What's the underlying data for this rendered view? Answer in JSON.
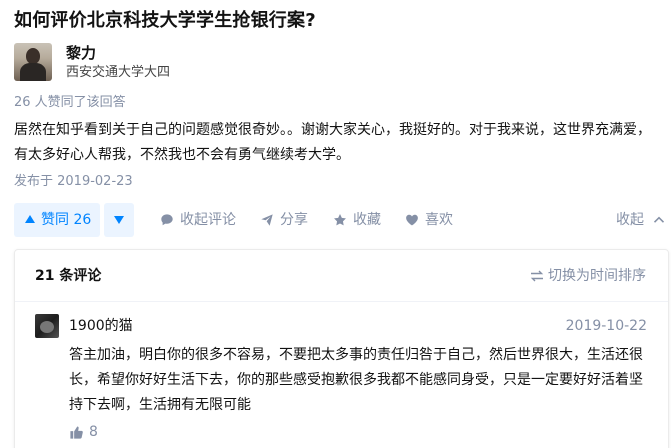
{
  "question": {
    "title": "如何评价北京科技大学学生抢银行案?"
  },
  "author": {
    "name": "黎力",
    "bio": "西安交通大学大四"
  },
  "answer": {
    "vote_summary": "26 人赞同了该回答",
    "content": "居然在知乎看到关于自己的问题感觉很奇妙。。谢谢大家关心，我挺好的。对于我来说，这世界充满爱，有太多好心人帮我，不然我也不会有勇气继续考大学。",
    "published": "发布于 2019-02-23"
  },
  "actions": {
    "upvote_label": "赞同 26",
    "comment_label": "收起评论",
    "share_label": "分享",
    "collect_label": "收藏",
    "like_label": "喜欢",
    "collapse_label": "收起"
  },
  "comments": {
    "count_label": "21 条评论",
    "sort_label": "切换为时间排序",
    "items": [
      {
        "user": "1900的猫",
        "time": "2019-10-22",
        "text": "答主加油，明白你的很多不容易，不要把太多事的责任归咎于自己，然后世界很大，生活还很长，希望你好好生活下去，你的那些感受抱歉很多我都不能感同身受，只是一定要好好活着坚持下去啊，生活拥有无限可能",
        "likes": "8"
      }
    ]
  },
  "colors": {
    "accent": "#0084ff",
    "accent_bg": "#ebf4ff",
    "muted": "#8590a6",
    "text": "#121212"
  }
}
